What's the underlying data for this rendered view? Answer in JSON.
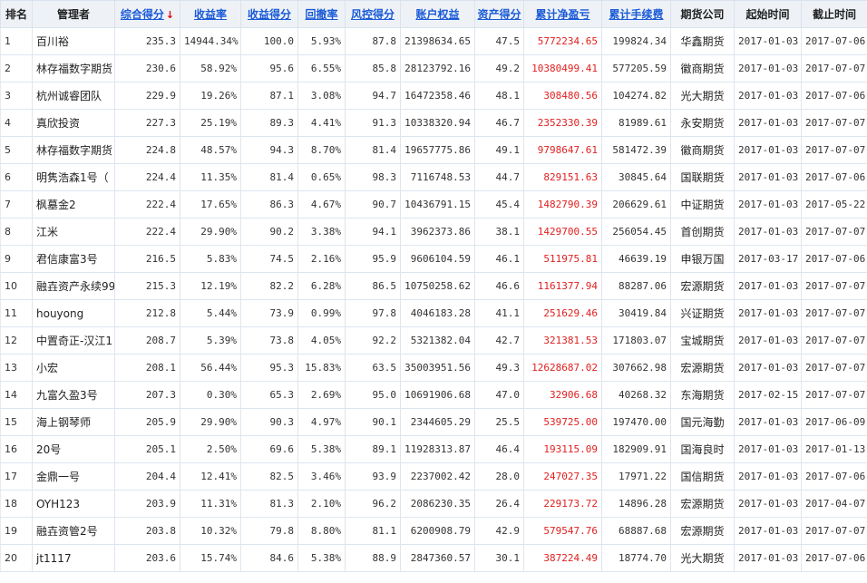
{
  "headers": [
    {
      "label": "排名",
      "sortable": false
    },
    {
      "label": "管理者",
      "sortable": false
    },
    {
      "label": "综合得分",
      "sortable": true,
      "sorted": true,
      "arrow": "↓"
    },
    {
      "label": "收益率",
      "sortable": true
    },
    {
      "label": "收益得分",
      "sortable": true
    },
    {
      "label": "回撤率",
      "sortable": true
    },
    {
      "label": "风控得分",
      "sortable": true
    },
    {
      "label": "账户权益",
      "sortable": true
    },
    {
      "label": "资产得分",
      "sortable": true
    },
    {
      "label": "累计净盈亏",
      "sortable": true
    },
    {
      "label": "累计手续费",
      "sortable": true
    },
    {
      "label": "期货公司",
      "sortable": false
    },
    {
      "label": "起始时间",
      "sortable": false
    },
    {
      "label": "截止时间",
      "sortable": false
    }
  ],
  "rows": [
    [
      "1",
      "百川裕",
      "235.3",
      "14944.34%",
      "100.0",
      "5.93%",
      "87.8",
      "21398634.65",
      "47.5",
      "5772234.65",
      "199824.34",
      "华鑫期货",
      "2017-01-03",
      "2017-07-06"
    ],
    [
      "2",
      "林存福数字期货",
      "230.6",
      "58.92%",
      "95.6",
      "6.55%",
      "85.8",
      "28123792.16",
      "49.2",
      "10380499.41",
      "577205.59",
      "徽商期货",
      "2017-01-03",
      "2017-07-07"
    ],
    [
      "3",
      "杭州诚睿团队",
      "229.9",
      "19.26%",
      "87.1",
      "3.08%",
      "94.7",
      "16472358.46",
      "48.1",
      "308480.56",
      "104274.82",
      "光大期货",
      "2017-01-03",
      "2017-07-06"
    ],
    [
      "4",
      "真欣投资",
      "227.3",
      "25.19%",
      "89.3",
      "4.41%",
      "91.3",
      "10338320.94",
      "46.7",
      "2352330.39",
      "81989.61",
      "永安期货",
      "2017-01-03",
      "2017-07-07"
    ],
    [
      "5",
      "林存福数字期货",
      "224.8",
      "48.57%",
      "94.3",
      "8.70%",
      "81.4",
      "19657775.86",
      "49.1",
      "9798647.61",
      "581472.39",
      "徽商期货",
      "2017-01-03",
      "2017-07-07"
    ],
    [
      "6",
      "明隽浩森1号（",
      "224.4",
      "11.35%",
      "81.4",
      "0.65%",
      "98.3",
      "7116748.53",
      "44.7",
      "829151.63",
      "30845.64",
      "国联期货",
      "2017-01-03",
      "2017-07-06"
    ],
    [
      "7",
      "枫墓金2",
      "222.4",
      "17.65%",
      "86.3",
      "4.67%",
      "90.7",
      "10436791.15",
      "45.4",
      "1482790.39",
      "206629.61",
      "中证期货",
      "2017-01-03",
      "2017-05-22"
    ],
    [
      "8",
      "江米",
      "222.4",
      "29.90%",
      "90.2",
      "3.38%",
      "94.1",
      "3962373.86",
      "38.1",
      "1429700.55",
      "256054.45",
      "首创期货",
      "2017-01-03",
      "2017-07-07"
    ],
    [
      "9",
      "君信康富3号",
      "216.5",
      "5.83%",
      "74.5",
      "2.16%",
      "95.9",
      "9606104.59",
      "46.1",
      "511975.81",
      "46639.19",
      "申银万国",
      "2017-03-17",
      "2017-07-06"
    ],
    [
      "10",
      "融壵资产永续99",
      "215.3",
      "12.19%",
      "82.2",
      "6.28%",
      "86.5",
      "10750258.62",
      "46.6",
      "1161377.94",
      "88287.06",
      "宏源期货",
      "2017-01-03",
      "2017-07-07"
    ],
    [
      "11",
      "houyong",
      "212.8",
      "5.44%",
      "73.9",
      "0.99%",
      "97.8",
      "4046183.28",
      "41.1",
      "251629.46",
      "30419.84",
      "兴证期货",
      "2017-01-03",
      "2017-07-07"
    ],
    [
      "12",
      "中置奇正-汉江1",
      "208.7",
      "5.39%",
      "73.8",
      "4.05%",
      "92.2",
      "5321382.04",
      "42.7",
      "321381.53",
      "171803.07",
      "宝城期货",
      "2017-01-03",
      "2017-07-07"
    ],
    [
      "13",
      "小宏",
      "208.1",
      "56.44%",
      "95.3",
      "15.83%",
      "63.5",
      "35003951.56",
      "49.3",
      "12628687.02",
      "307662.98",
      "宏源期货",
      "2017-01-03",
      "2017-07-07"
    ],
    [
      "14",
      "九富久盈3号",
      "207.3",
      "0.30%",
      "65.3",
      "2.69%",
      "95.0",
      "10691906.68",
      "47.0",
      "32906.68",
      "40268.32",
      "东海期货",
      "2017-02-15",
      "2017-07-07"
    ],
    [
      "15",
      "海上钢琴师",
      "205.9",
      "29.90%",
      "90.3",
      "4.97%",
      "90.1",
      "2344605.29",
      "25.5",
      "539725.00",
      "197470.00",
      "国元海勤",
      "2017-01-03",
      "2017-06-09"
    ],
    [
      "16",
      "20号",
      "205.1",
      "2.50%",
      "69.6",
      "5.38%",
      "89.1",
      "11928313.87",
      "46.4",
      "193115.09",
      "182909.91",
      "国海良时",
      "2017-01-03",
      "2017-01-13"
    ],
    [
      "17",
      "金鼎一号",
      "204.4",
      "12.41%",
      "82.5",
      "3.46%",
      "93.9",
      "2237002.42",
      "28.0",
      "247027.35",
      "17971.22",
      "国信期货",
      "2017-01-03",
      "2017-07-06"
    ],
    [
      "18",
      "OYH123",
      "203.9",
      "11.31%",
      "81.3",
      "2.10%",
      "96.2",
      "2086230.35",
      "26.4",
      "229173.72",
      "14896.28",
      "宏源期货",
      "2017-01-03",
      "2017-04-07"
    ],
    [
      "19",
      "融壵资管2号",
      "203.8",
      "10.32%",
      "79.8",
      "8.80%",
      "81.1",
      "6200908.79",
      "42.9",
      "579547.76",
      "68887.68",
      "宏源期货",
      "2017-01-03",
      "2017-07-07"
    ],
    [
      "20",
      "jt1117",
      "203.6",
      "15.74%",
      "84.6",
      "5.38%",
      "88.9",
      "2847360.57",
      "30.1",
      "387224.49",
      "18774.70",
      "光大期货",
      "2017-01-03",
      "2017-07-06"
    ]
  ]
}
